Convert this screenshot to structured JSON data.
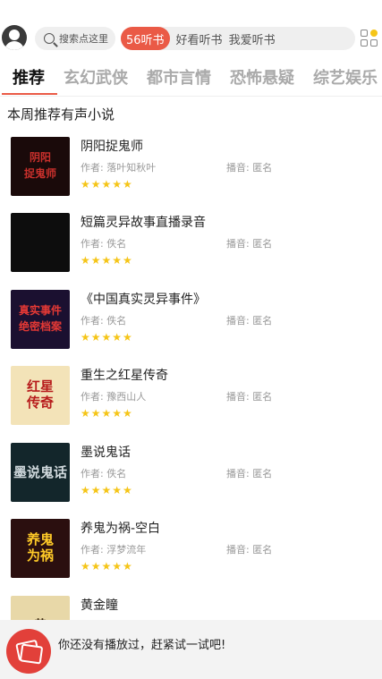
{
  "header": {
    "search_placeholder": "搜索点这里",
    "pills": [
      {
        "label": "56听书",
        "active": true
      },
      {
        "label": "好看听书",
        "active": false
      },
      {
        "label": "我爱听书",
        "active": false
      }
    ]
  },
  "tabs": [
    {
      "label": "推荐",
      "active": true
    },
    {
      "label": "玄幻武侠",
      "active": false
    },
    {
      "label": "都市言情",
      "active": false
    },
    {
      "label": "恐怖悬疑",
      "active": false
    },
    {
      "label": "综艺娱乐",
      "active": false
    }
  ],
  "section_title": "本周推荐有声小说",
  "books": [
    {
      "title": "阴阳捉鬼师",
      "author": "作者: 落叶知秋叶",
      "narrator": "播音: 匿名",
      "stars": "★★★★★",
      "cover_text": "阴阳\n捉鬼师",
      "cover_bg": "#1a0a0a",
      "cover_fg": "#c9302c"
    },
    {
      "title": "短篇灵异故事直播录音",
      "author": "作者: 佚名",
      "narrator": "播音: 匿名",
      "stars": "★★★★★",
      "cover_text": "",
      "cover_bg": "#0d0d0d",
      "cover_fg": "#d32f2f"
    },
    {
      "title": "《中国真实灵异事件》",
      "author": "作者: 佚名",
      "narrator": "播音: 匿名",
      "stars": "★★★★★",
      "cover_text": "真实事件\n绝密档案",
      "cover_bg": "#1b1030",
      "cover_fg": "#e53935"
    },
    {
      "title": "重生之红星传奇",
      "author": "作者: 豫西山人",
      "narrator": "播音: 匿名",
      "stars": "★★★★★",
      "cover_text": "红星\n传奇",
      "cover_bg": "#f3e3b8",
      "cover_fg": "#b71c1c"
    },
    {
      "title": "墨说鬼话",
      "author": "作者: 佚名",
      "narrator": "播音: 匿名",
      "stars": "★★★★★",
      "cover_text": "墨说鬼话",
      "cover_bg": "#13262b",
      "cover_fg": "#cfd8dc"
    },
    {
      "title": "养鬼为祸-空白",
      "author": "作者: 浮梦流年",
      "narrator": "播音: 匿名",
      "stars": "★★★★★",
      "cover_text": "养鬼\n为祸",
      "cover_bg": "#2b0f0f",
      "cover_fg": "#ffca28"
    },
    {
      "title": "黄金瞳",
      "author": "",
      "narrator": "",
      "stars": "",
      "cover_text": "黄",
      "cover_bg": "#e8d8a8",
      "cover_fg": "#3e2a10"
    }
  ],
  "player": {
    "message": "你还没有播放过，赶紧试一试吧!"
  },
  "colors": {
    "accent": "#ea5a46",
    "star": "#f5c518"
  }
}
